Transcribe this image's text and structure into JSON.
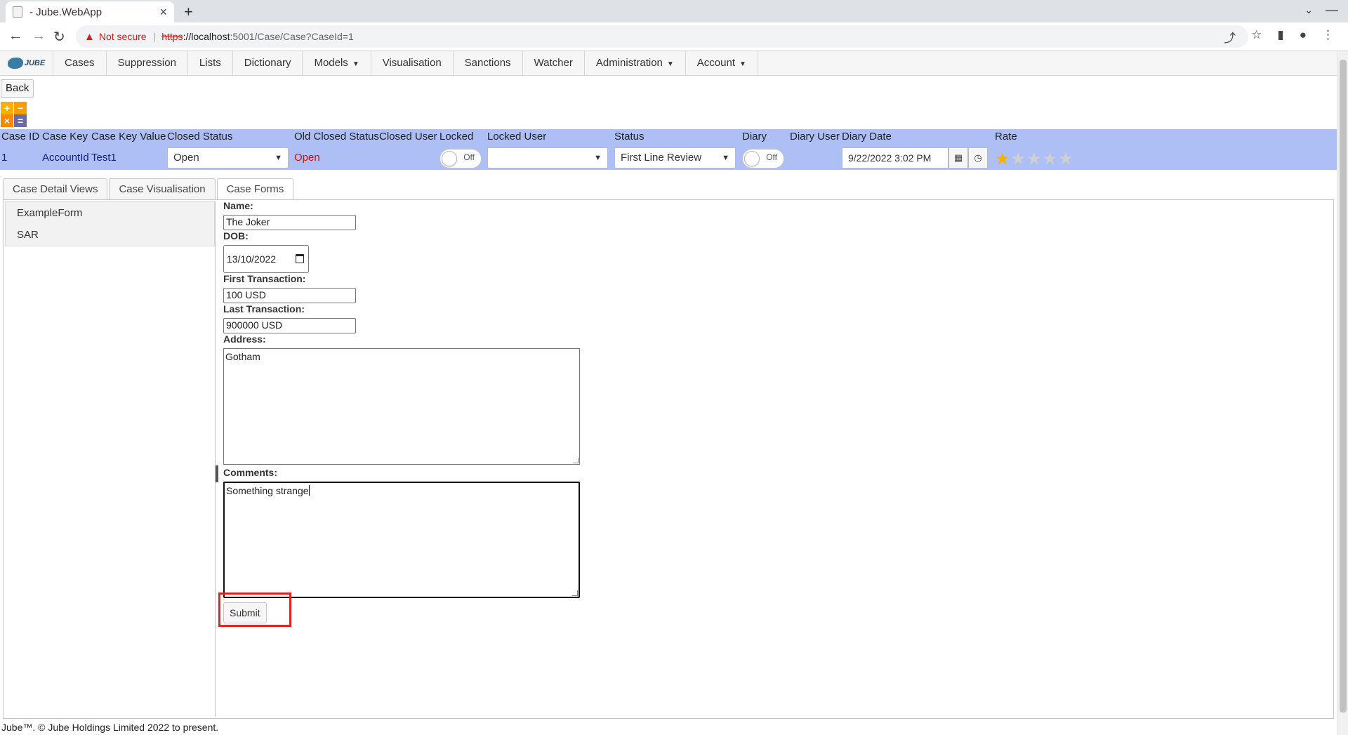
{
  "browser": {
    "tab_title": "- Jube.WebApp",
    "url_scheme": "https",
    "url_host": "://localhost",
    "url_path": ":5001/Case/Case?CaseId=1",
    "not_secure": "Not secure"
  },
  "menu": {
    "logo_text": "JUBE",
    "items": [
      {
        "label": "Cases",
        "dropdown": false
      },
      {
        "label": "Suppression",
        "dropdown": false
      },
      {
        "label": "Lists",
        "dropdown": false
      },
      {
        "label": "Dictionary",
        "dropdown": false
      },
      {
        "label": "Models",
        "dropdown": true
      },
      {
        "label": "Visualisation",
        "dropdown": false
      },
      {
        "label": "Sanctions",
        "dropdown": false
      },
      {
        "label": "Watcher",
        "dropdown": false
      },
      {
        "label": "Administration",
        "dropdown": true
      },
      {
        "label": "Account",
        "dropdown": true
      }
    ]
  },
  "page": {
    "back_label": "Back",
    "ops": {
      "plus": "+",
      "minus": "−",
      "times": "×",
      "equals": "="
    }
  },
  "case_header": {
    "labels": {
      "case_id": "Case ID",
      "case_key": "Case Key",
      "case_key_value": "Case Key Value",
      "closed_status": "Closed Status",
      "old_closed_status": "Old Closed Status",
      "closed_user": "Closed User",
      "locked": "Locked",
      "locked_user": "Locked User",
      "status": "Status",
      "diary": "Diary",
      "diary_user": "Diary User",
      "diary_date": "Diary Date",
      "rate": "Rate"
    },
    "values": {
      "case_id": "1",
      "case_key": "AccountId",
      "case_key_value": "Test1",
      "closed_status": "Open",
      "old_closed_status": "Open",
      "locked": "Off",
      "locked_user": "",
      "status": "First Line Review",
      "diary": "Off",
      "diary_date": "9/22/2022 3:02 PM",
      "rating": 1,
      "rating_max": 5
    },
    "colors": {
      "header_bg": "#aebff5",
      "old_status": "#d01010",
      "star": "#f5b100"
    }
  },
  "tabs": [
    {
      "label": "Case Detail Views",
      "active": false
    },
    {
      "label": "Case Visualisation",
      "active": false
    },
    {
      "label": "Case Forms",
      "active": true
    }
  ],
  "forms_list": [
    "ExampleForm",
    "SAR"
  ],
  "form": {
    "name_label": "Name:",
    "name_value": "The Joker",
    "dob_label": "DOB:",
    "dob_value": "13/10/2022",
    "first_tx_label": "First Transaction:",
    "first_tx_value": "100 USD",
    "last_tx_label": "Last Transaction:",
    "last_tx_value": "900000 USD",
    "address_label": "Address:",
    "address_value": "Gotham",
    "comments_label": "Comments:",
    "comments_value": "Something strange",
    "submit_label": "Submit"
  },
  "footer": "Jube™. © Jube Holdings Limited 2022 to present."
}
